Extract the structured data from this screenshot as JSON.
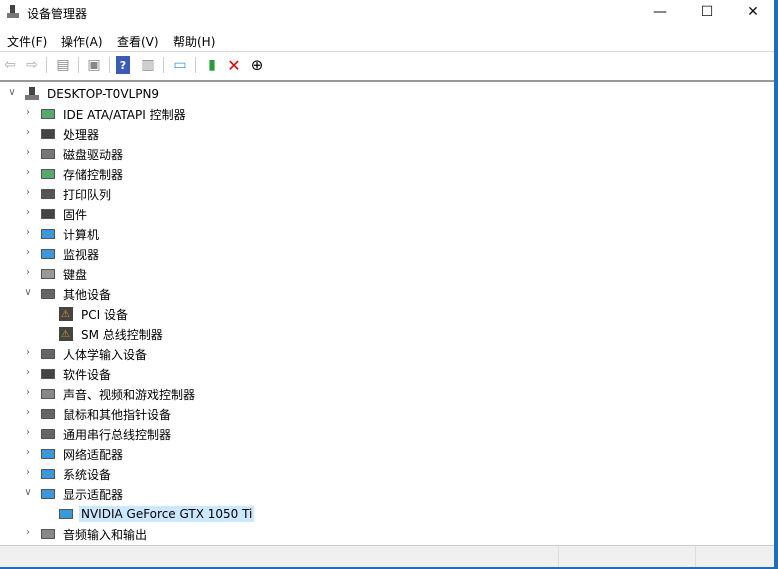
{
  "window": {
    "title": "设备管理器",
    "minimize": "—",
    "maximize": "☐",
    "close": "✕"
  },
  "menu": [
    "文件(F)",
    "操作(A)",
    "查看(V)",
    "帮助(H)"
  ],
  "toolbar": [
    "back-icon",
    "forward-icon",
    "show-hide-console-tree-icon",
    "properties-icon",
    "help-icon",
    "action-pane-icon",
    "scan-hardware-icon",
    "update-driver-icon",
    "uninstall-icon",
    "disable-icon"
  ],
  "tree": {
    "root": "DESKTOP-T0VLPN9",
    "items": [
      {
        "label": "IDE ATA/ATAPI 控制器",
        "level": 1,
        "state": "collapsed",
        "icon": "ide-icon",
        "color": "#5a7"
      },
      {
        "label": "处理器",
        "level": 1,
        "state": "collapsed",
        "icon": "cpu-icon",
        "color": "#444"
      },
      {
        "label": "磁盘驱动器",
        "level": 1,
        "state": "collapsed",
        "icon": "disk-icon",
        "color": "#777"
      },
      {
        "label": "存储控制器",
        "level": 1,
        "state": "collapsed",
        "icon": "storage-icon",
        "color": "#5a7"
      },
      {
        "label": "打印队列",
        "level": 1,
        "state": "collapsed",
        "icon": "printer-icon",
        "color": "#555"
      },
      {
        "label": "固件",
        "level": 1,
        "state": "collapsed",
        "icon": "firmware-icon",
        "color": "#444"
      },
      {
        "label": "计算机",
        "level": 1,
        "state": "collapsed",
        "icon": "computer-icon",
        "color": "#3a9ad9"
      },
      {
        "label": "监视器",
        "level": 1,
        "state": "collapsed",
        "icon": "monitor-icon",
        "color": "#3a9ad9"
      },
      {
        "label": "键盘",
        "level": 1,
        "state": "collapsed",
        "icon": "keyboard-icon",
        "color": "#999"
      },
      {
        "label": "其他设备",
        "level": 1,
        "state": "expanded",
        "icon": "other-devices-icon",
        "color": "#666"
      },
      {
        "label": "PCI 设备",
        "level": 2,
        "state": "leaf",
        "icon": "warning-device-icon",
        "color": "#e8a000"
      },
      {
        "label": "SM 总线控制器",
        "level": 2,
        "state": "leaf",
        "icon": "warning-device-icon",
        "color": "#e8a000"
      },
      {
        "label": "人体学输入设备",
        "level": 1,
        "state": "collapsed",
        "icon": "hid-icon",
        "color": "#666"
      },
      {
        "label": "软件设备",
        "level": 1,
        "state": "collapsed",
        "icon": "software-device-icon",
        "color": "#444"
      },
      {
        "label": "声音、视频和游戏控制器",
        "level": 1,
        "state": "collapsed",
        "icon": "sound-icon",
        "color": "#888"
      },
      {
        "label": "鼠标和其他指针设备",
        "level": 1,
        "state": "collapsed",
        "icon": "mouse-icon",
        "color": "#666"
      },
      {
        "label": "通用串行总线控制器",
        "level": 1,
        "state": "collapsed",
        "icon": "usb-icon",
        "color": "#666"
      },
      {
        "label": "网络适配器",
        "level": 1,
        "state": "collapsed",
        "icon": "network-icon",
        "color": "#3a9ad9"
      },
      {
        "label": "系统设备",
        "level": 1,
        "state": "collapsed",
        "icon": "system-device-icon",
        "color": "#3a9ad9"
      },
      {
        "label": "显示适配器",
        "level": 1,
        "state": "expanded",
        "icon": "display-adapter-icon",
        "color": "#3a9ad9"
      },
      {
        "label": "NVIDIA GeForce GTX 1050 Ti",
        "level": 2,
        "state": "selected",
        "icon": "display-adapter-icon",
        "color": "#3a9ad9"
      },
      {
        "label": "音频输入和输出",
        "level": 1,
        "state": "collapsed",
        "icon": "audio-icon",
        "color": "#888"
      }
    ]
  }
}
